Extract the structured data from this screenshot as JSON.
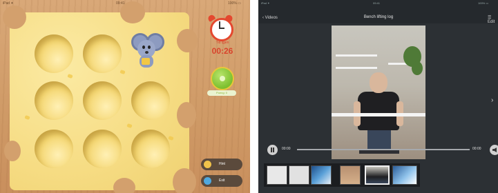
{
  "left_app": {
    "status": {
      "carrier": "iPad ✦",
      "time": "09:41",
      "battery": "100% ▭"
    },
    "timer_caption": "Tid igjen",
    "timer": "00:26",
    "score_caption": "Poeng: 0",
    "buttons": [
      {
        "label": "Hint"
      },
      {
        "label": "Exit"
      }
    ],
    "colors": {
      "timer": "#d8442c",
      "accent_green": "#8ab63a",
      "pill": "#5b4a3c"
    }
  },
  "right_app": {
    "status": {
      "carrier": "iPad ✦",
      "time": "09:41",
      "battery": "100% ▭"
    },
    "back_label": "‹ Videos",
    "title": "Bench lifting log",
    "menu_label": "☰ Edit",
    "next_glyph": "›",
    "time_current": "00:00",
    "time_end": "00:00",
    "thumbnails": [
      {
        "kind": "doc"
      },
      {
        "kind": "doc"
      },
      {
        "kind": "blue"
      },
      {
        "kind": "room"
      },
      {
        "kind": "selected"
      },
      {
        "kind": "blue"
      }
    ]
  }
}
